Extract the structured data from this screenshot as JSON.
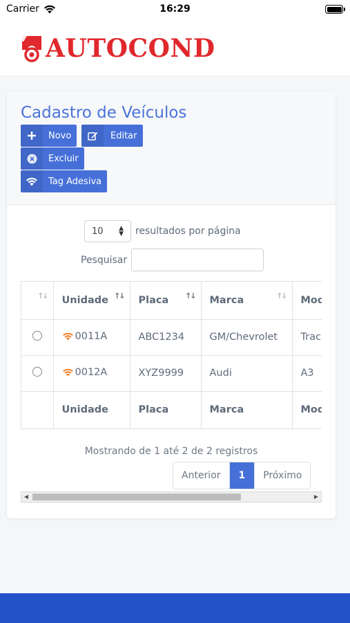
{
  "status_bar": {
    "carrier": "Carrier",
    "time": "16:29"
  },
  "brand": {
    "name": "AUTOCOND",
    "color": "#e0282d"
  },
  "page": {
    "title": "Cadastro de Veículos"
  },
  "toolbar": {
    "new_label": "Novo",
    "edit_label": "Editar",
    "delete_label": "Excluir",
    "tag_label": "Tag Adesiva"
  },
  "datatable": {
    "length_value": "10",
    "length_label": "resultados por página",
    "search_label": "Pesquisar",
    "search_value": "",
    "columns": [
      "",
      "Unidade",
      "Placa",
      "Marca",
      "Modelo"
    ],
    "rows": [
      {
        "unidade": "0011A",
        "placa": "ABC1234",
        "marca": "GM/Chevrolet",
        "modelo": "Tracker"
      },
      {
        "unidade": "0012A",
        "placa": "XYZ9999",
        "marca": "Audi",
        "modelo": "A3"
      }
    ],
    "footer_columns": [
      "",
      "Unidade",
      "Placa",
      "Marca",
      "Modelo"
    ],
    "info": "Mostrando de 1 até 2 de 2 registros",
    "pagination": {
      "prev": "Anterior",
      "current": "1",
      "next": "Próximo"
    }
  },
  "colors": {
    "accent": "#4670d8",
    "tag_icon": "#f07f2a",
    "bottom_bar": "#2352c8"
  }
}
